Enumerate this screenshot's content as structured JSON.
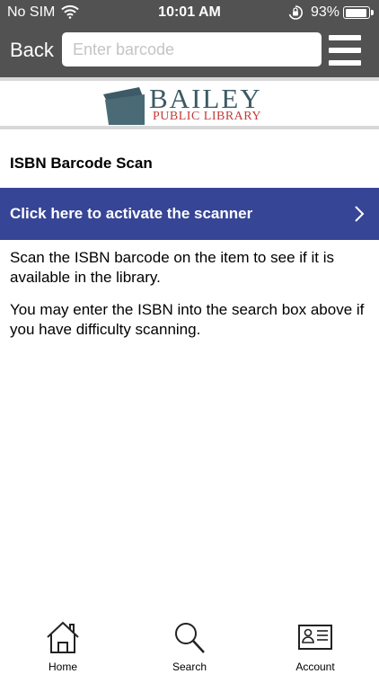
{
  "status_bar": {
    "carrier": "No SIM",
    "time": "10:01 AM",
    "battery_percent_text": "93%",
    "battery_level": 0.93,
    "icons": [
      "wifi-icon",
      "orientation-lock-icon",
      "battery-icon"
    ]
  },
  "nav": {
    "back_label": "Back",
    "search_placeholder": "Enter barcode",
    "search_value": "",
    "menu_icon": "hamburger-menu-icon"
  },
  "logo": {
    "title": "BAILEY",
    "subtitle": "PUBLIC LIBRARY",
    "colors": {
      "title": "#3d5a66",
      "subtitle": "#c23b3b",
      "mark": "#3d5a66"
    }
  },
  "page": {
    "title": "ISBN Barcode Scan",
    "scanner_button_label": "Click here to activate the scanner",
    "scanner_button_color": "#374596",
    "paragraph_1": "Scan the ISBN barcode on the item to see if it is available in the library.",
    "paragraph_2": "You may enter the ISBN into the search box above if you have difficulty scanning."
  },
  "tab_bar": {
    "items": [
      {
        "label": "Home",
        "icon": "home-icon"
      },
      {
        "label": "Search",
        "icon": "search-icon"
      },
      {
        "label": "Account",
        "icon": "account-card-icon"
      }
    ]
  }
}
